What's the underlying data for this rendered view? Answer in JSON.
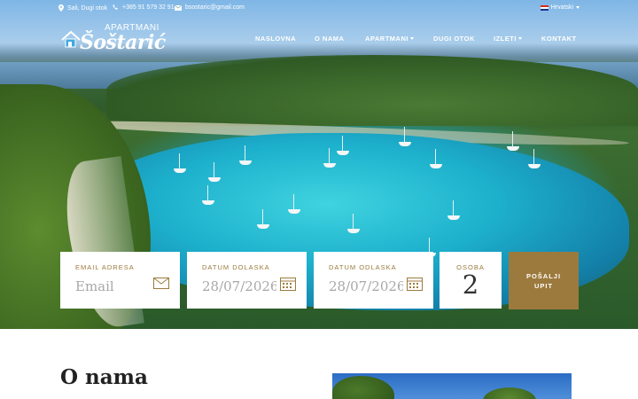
{
  "topbar": {
    "location": "Sali, Dugi otok",
    "phone": "+385 91 579 32 91",
    "email": "bsostaric@gmail.com",
    "language": "Hrvatski"
  },
  "logo": {
    "top_text": "APARTMANI",
    "name": "Šoštarić"
  },
  "nav": {
    "items": [
      {
        "label": "NASLOVNA"
      },
      {
        "label": "O NAMA"
      },
      {
        "label": "APARTMANI"
      },
      {
        "label": "DUGI OTOK"
      },
      {
        "label": "IZLETI"
      },
      {
        "label": "KONTAKT"
      }
    ]
  },
  "booking": {
    "email_label": "EMAIL ADRESA",
    "email_placeholder": "Email",
    "arrival_label": "DATUM DOLASKA",
    "arrival_value": "28/07/2026",
    "departure_label": "DATUM ODLASKA",
    "departure_value": "28/07/2026",
    "guests_label": "OSOBA",
    "guests_value": "2",
    "send_label_line1": "POŠALJI",
    "send_label_line2": "UPIT"
  },
  "about": {
    "title": "O nama"
  },
  "icons": {
    "location": "map-pin-icon",
    "phone": "phone-icon",
    "email": "envelope-icon",
    "calendar": "calendar-icon"
  },
  "colors": {
    "accent": "#9c7a3d",
    "label": "#9a7a3c"
  }
}
